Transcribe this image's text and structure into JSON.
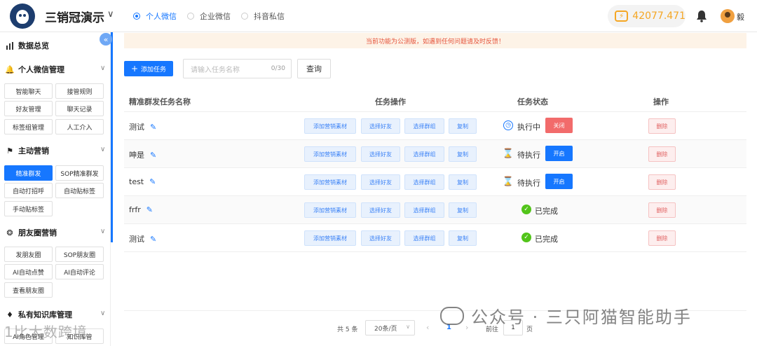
{
  "header": {
    "app_title": "三销冠演示",
    "account_types": [
      {
        "label": "个人微信",
        "active": true
      },
      {
        "label": "企业微信",
        "active": false
      },
      {
        "label": "抖音私信",
        "active": false
      }
    ],
    "balance": "42077.471",
    "user_name": "毅",
    "colors": {
      "accent": "#1677ff",
      "balance": "#f5a623"
    }
  },
  "sidebar": {
    "collapse_icon": "double-chevron-left-icon",
    "dashboard": "数据总览",
    "sections": [
      {
        "title": "个人微信管理",
        "icon": "bell-icon",
        "items": [
          "智能聊天",
          "接管规则",
          "好友管理",
          "聊天记录",
          "标签组管理",
          "人工介入"
        ]
      },
      {
        "title": "主动营销",
        "icon": "flag-icon",
        "items": [
          "精准群发",
          "SOP精准群发",
          "自动打招呼",
          "自动贴标签",
          "手动贴标签"
        ],
        "active_item": "精准群发"
      },
      {
        "title": "朋友圈营销",
        "icon": "aperture-icon",
        "items": [
          "发朋友圈",
          "SOP朋友圈",
          "AI自动点赞",
          "AI自动评论",
          "查看朋友圈"
        ]
      },
      {
        "title": "私有知识库管理",
        "icon": "tag-icon",
        "items": [
          "AI角色管理",
          "知识库管"
        ]
      }
    ]
  },
  "notice": "当前功能为公测版，如遇到任何问题请及时反馈！",
  "toolbar": {
    "add_label": "添加任务",
    "search_placeholder": "请输入任务名称",
    "search_count": "0/30",
    "query_label": "查询"
  },
  "table": {
    "headers": {
      "name": "精准群发任务名称",
      "ops": "任务操作",
      "status": "任务状态",
      "actions": "操作"
    },
    "op_labels": [
      "添加营销素材",
      "选择好友",
      "选择群组",
      "复制"
    ],
    "delete_label": "删除",
    "rows": [
      {
        "name": "测试",
        "status": "执行中",
        "status_icon": "clock-icon",
        "toggle": "关闭"
      },
      {
        "name": "呻是",
        "status": "待执行",
        "status_icon": "hourglass-icon",
        "toggle": "开启"
      },
      {
        "name": "test",
        "status": "待执行",
        "status_icon": "hourglass-icon",
        "toggle": "开启"
      },
      {
        "name": "frfr",
        "status": "已完成",
        "status_icon": "check-circle-icon",
        "toggle": ""
      },
      {
        "name": "测试",
        "status": "已完成",
        "status_icon": "check-circle-icon",
        "toggle": ""
      }
    ]
  },
  "pagination": {
    "total": "共 5 条",
    "page_size": "20条/页",
    "current_page": "1",
    "goto_prefix": "前往",
    "goto_value": "1",
    "goto_suffix": "页"
  },
  "watermarks": {
    "main": "公众号 · 三只阿猫智能助手",
    "corner": "1比大数跨境"
  }
}
